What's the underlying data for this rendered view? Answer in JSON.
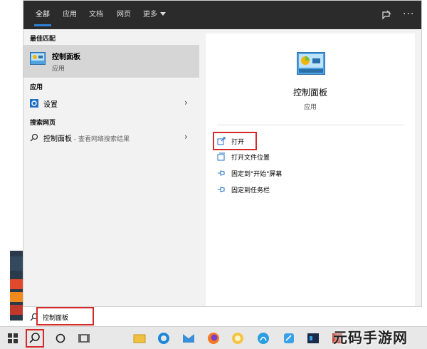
{
  "topbar": {
    "tabs": [
      {
        "label": "全部",
        "active": true
      },
      {
        "label": "应用",
        "active": false
      },
      {
        "label": "文档",
        "active": false
      },
      {
        "label": "网页",
        "active": false
      },
      {
        "label": "更多",
        "active": false
      }
    ],
    "more_glyph": "···",
    "icons": [
      "feedback-icon",
      "more-options-icon"
    ]
  },
  "left": {
    "best_match_heading": "最佳匹配",
    "best_match": {
      "title": "控制面板",
      "subtitle": "应用",
      "icon": "control-panel-icon"
    },
    "apps_heading": "应用",
    "settings_item": {
      "label": "设置",
      "icon": "gear-icon"
    },
    "web_heading": "搜索网页",
    "web_item": {
      "label": "控制面板",
      "sub": " - 查看网络搜索结果",
      "icon": "search-icon"
    },
    "chevron": "›"
  },
  "right": {
    "title": "控制面板",
    "subtitle": "应用",
    "actions": [
      {
        "label": "打开",
        "icon": "open-icon"
      },
      {
        "label": "打开文件位置",
        "icon": "folder-icon"
      },
      {
        "label": "固定到\"开始\"屏幕",
        "icon": "pin-icon"
      },
      {
        "label": "固定到任务栏",
        "icon": "pin-icon"
      }
    ]
  },
  "search": {
    "value": "控制面板"
  },
  "watermark": "元码手游网",
  "colors": {
    "accent": "#2f80d8",
    "highlight": "#d42a2a",
    "topbar": "#2b2b2b"
  }
}
